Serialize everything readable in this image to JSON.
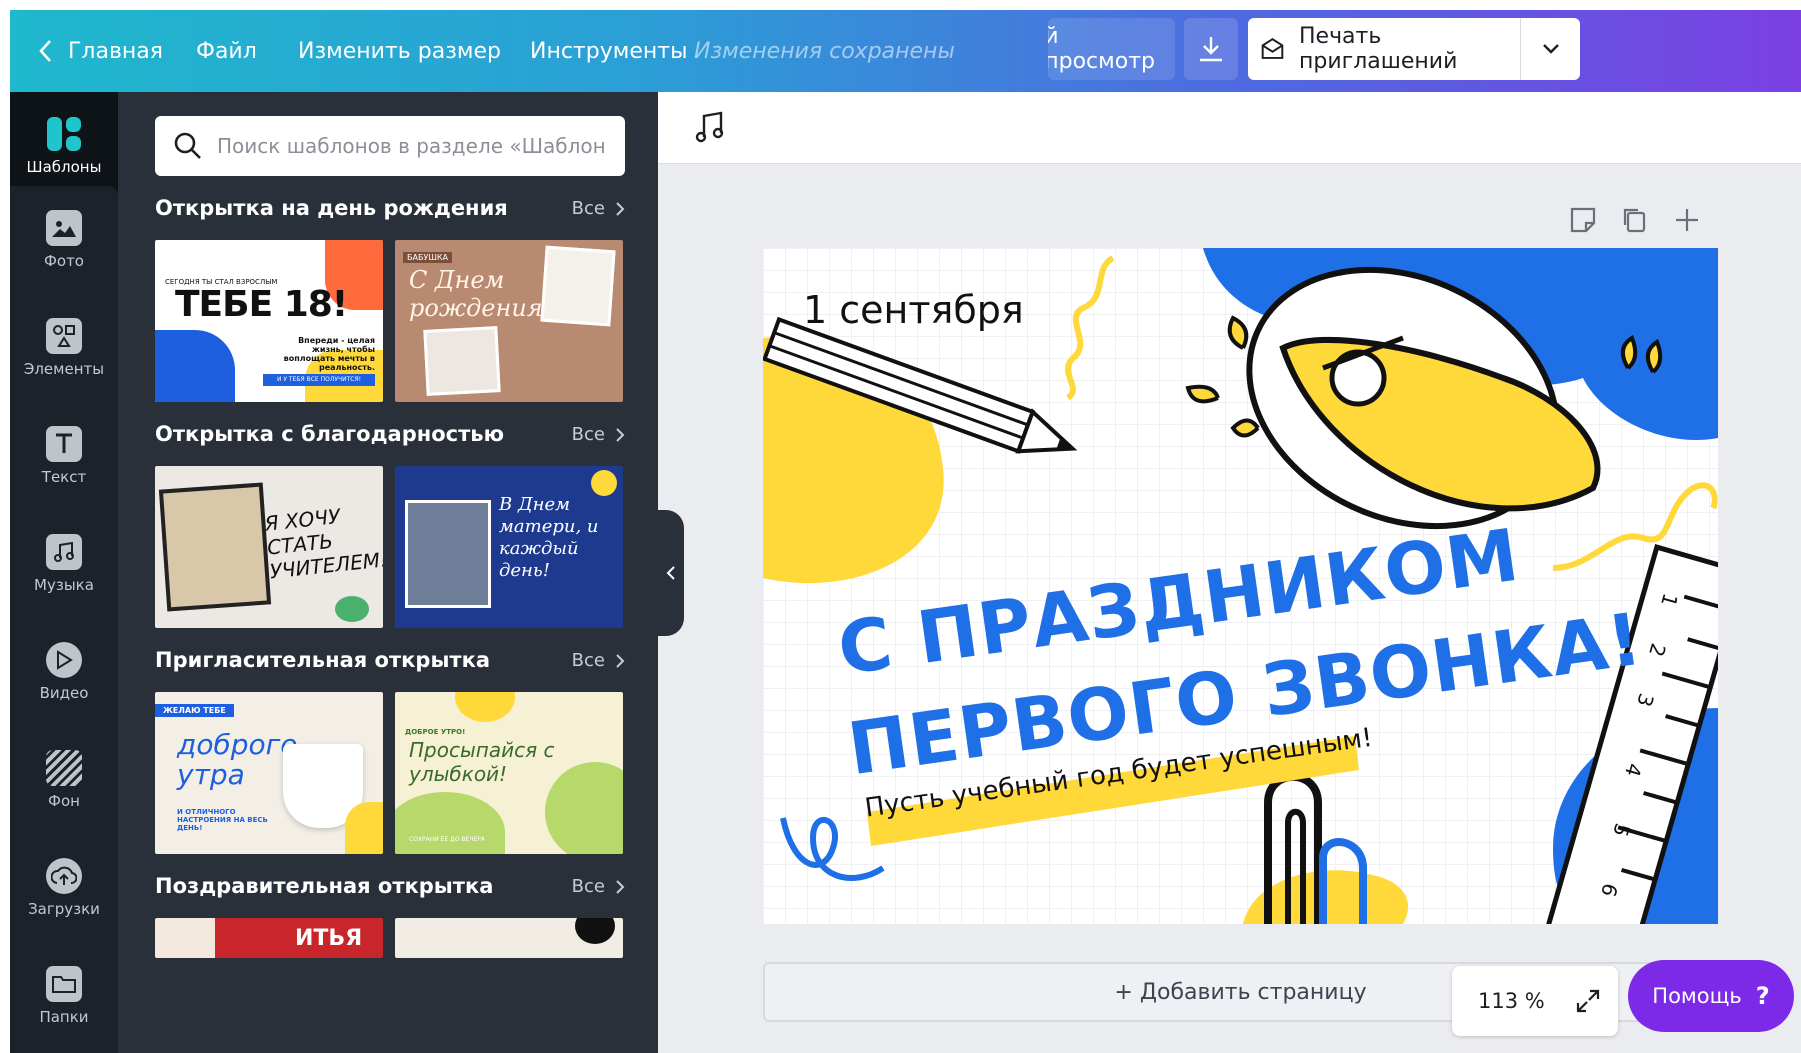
{
  "topbar": {
    "back_label": "Главная",
    "file": "Файл",
    "resize": "Изменить размер",
    "tools": "Инструменты",
    "saved_status": "Изменения сохранены",
    "preview": "й просмотр",
    "print": "Печать приглашений",
    "colors": {
      "gradient_start": "#1fb8cd",
      "gradient_end": "#7b3fe4"
    }
  },
  "rail": {
    "items": [
      {
        "label": "Шаблоны",
        "icon": "templates-icon"
      },
      {
        "label": "Фото",
        "icon": "photo-icon"
      },
      {
        "label": "Элементы",
        "icon": "elements-icon"
      },
      {
        "label": "Текст",
        "icon": "text-icon"
      },
      {
        "label": "Музыка",
        "icon": "music-icon"
      },
      {
        "label": "Видео",
        "icon": "video-icon"
      },
      {
        "label": "Фон",
        "icon": "background-icon"
      },
      {
        "label": "Загрузки",
        "icon": "uploads-icon"
      },
      {
        "label": "Папки",
        "icon": "folders-icon"
      }
    ]
  },
  "panel": {
    "search_placeholder": "Поиск шаблонов в разделе «Шаблон",
    "see_all": "Все",
    "sections": [
      {
        "title": "Открытка на день рождения",
        "thumbs": [
          {
            "lines": [
              "СЕГОДНЯ ТЫ СТАЛ ВЗРОСЛЫМ",
              "ТЕБЕ 18!",
              "Впереди - целая жизнь, чтобы воплощать мечты в реальность.",
              "И У ТЕБЯ ВСЕ ПОЛУЧИТСЯ!"
            ]
          },
          {
            "lines": [
              "БАБУШКА",
              "С Днем рождения!"
            ]
          }
        ]
      },
      {
        "title": "Открытка с благодарностью",
        "thumbs": [
          {
            "lines": [
              "Я ХОЧУ СТАТЬ УЧИТЕЛЕМ!"
            ]
          },
          {
            "lines": [
              "В Днем матери, и каждый день!"
            ]
          }
        ]
      },
      {
        "title": "Пригласительная открытка",
        "thumbs": [
          {
            "lines": [
              "ЖЕЛАЮ ТЕБЕ",
              "доброго утра",
              "И ОТЛИЧНОГО НАСТРОЕНИЯ НА ВЕСЬ ДЕНЬ!"
            ]
          },
          {
            "lines": [
              "ДОБРОЕ УТРО!",
              "Просыпайся с улыбкой!",
              "СОХРАНИ ЕЕ ДО ВЕЧЕРА"
            ]
          }
        ]
      },
      {
        "title": "Поздравительная открытка",
        "thumbs": [
          {
            "lines": [
              "ИТЬЯ"
            ]
          },
          {
            "lines": []
          }
        ]
      }
    ]
  },
  "canvas": {
    "date": "1 сентября",
    "headline_1": "С ПРАЗДНИКОМ",
    "headline_2": "ПЕРВОГО ЗВОНКА!",
    "subline": "Пусть учебный год будет успешным!",
    "ruler_numbers": [
      "1",
      "2",
      "3",
      "4",
      "5",
      "6"
    ],
    "colors": {
      "blue": "#1f6fe6",
      "yellow": "#ffd83a"
    }
  },
  "footer": {
    "add_page": "+ Добавить страницу",
    "zoom": "113 %",
    "help": "Помощь",
    "help_mark": "?"
  }
}
